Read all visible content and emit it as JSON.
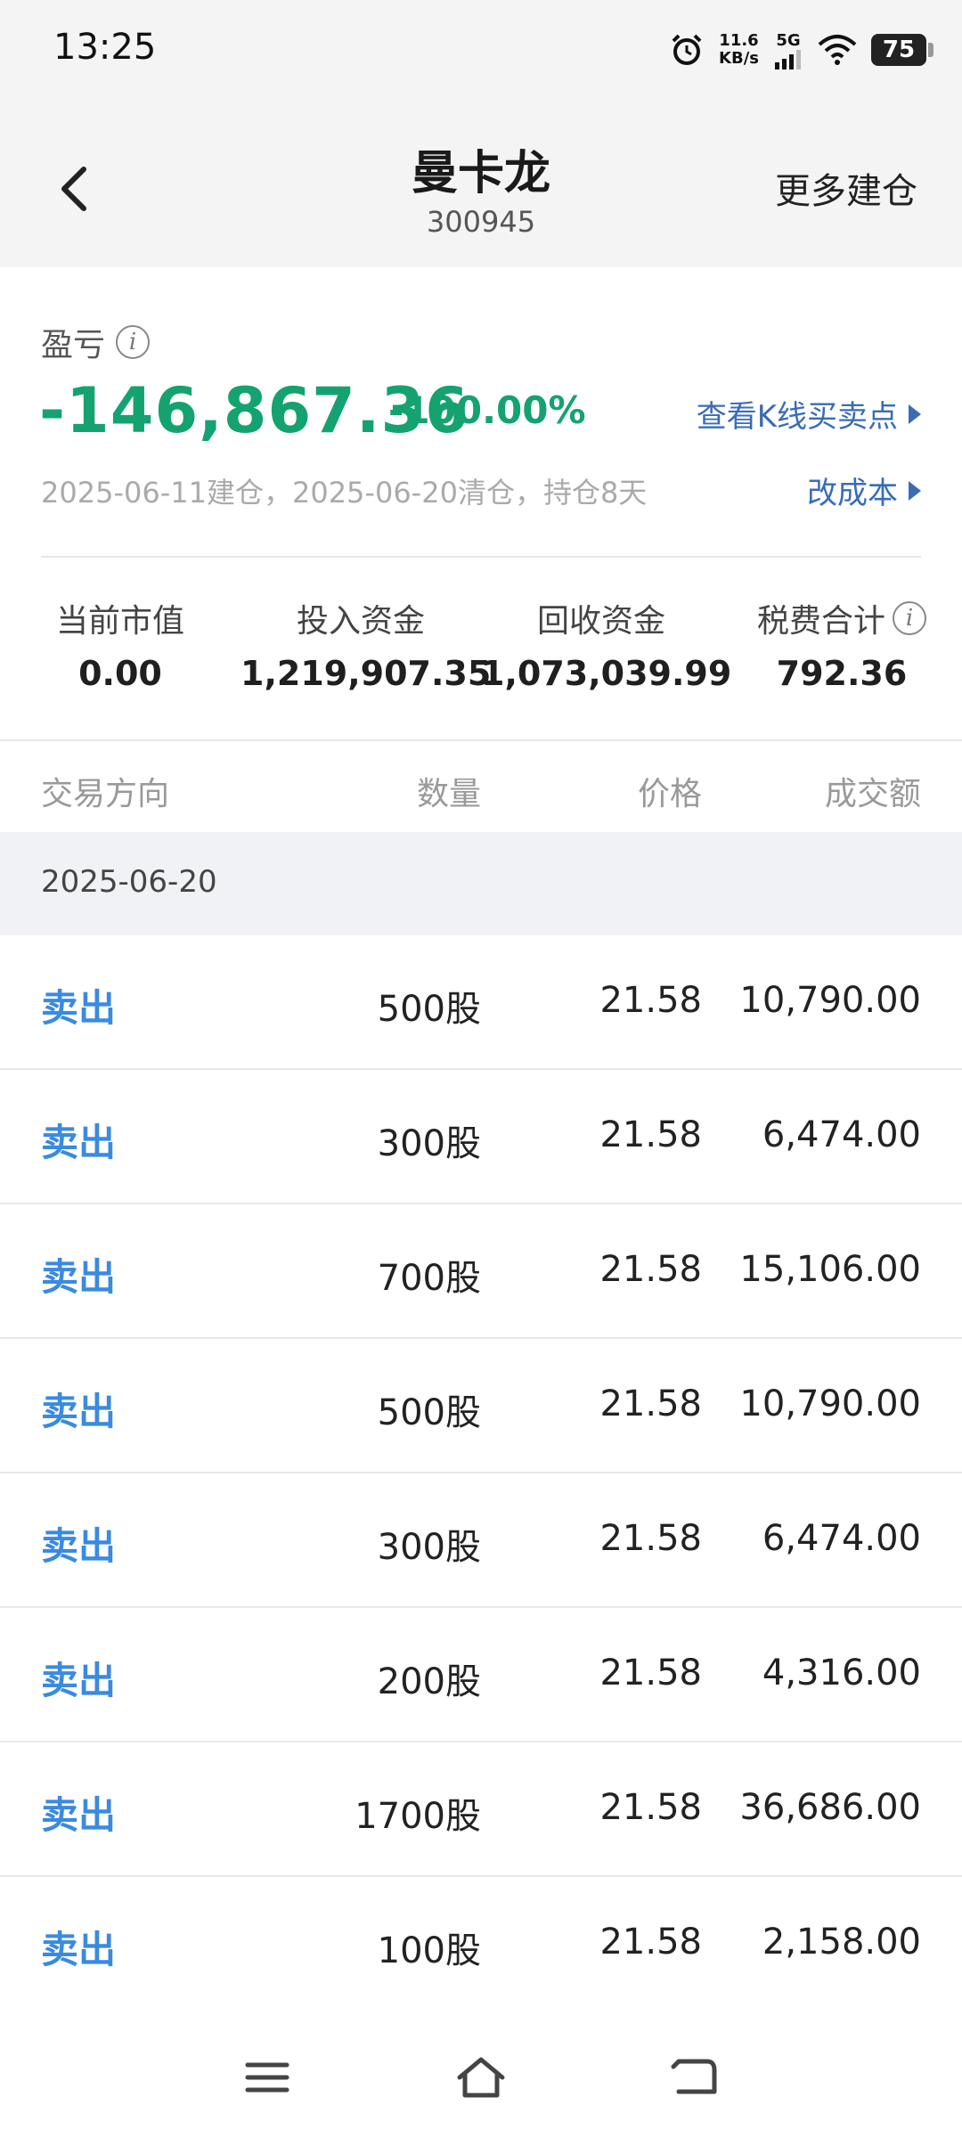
{
  "status": {
    "time": "13:25",
    "net_speed_value": "11.6",
    "net_speed_unit": "KB/s",
    "network": "5G",
    "battery": "75"
  },
  "nav": {
    "title": "曼卡龙",
    "code": "300945",
    "more": "更多建仓"
  },
  "summary": {
    "pl_label": "盈亏",
    "pl_value": "-146,867.36",
    "pl_pct": "-100.00%",
    "kline_link": "查看K线买卖点",
    "dates": "2025-06-11建仓，2025-06-20清仓，持仓8天",
    "cost_link": "改成本",
    "stats": [
      {
        "label": "当前市值",
        "value": "0.00"
      },
      {
        "label": "投入资金",
        "value": "1,219,907.35"
      },
      {
        "label": "回收资金",
        "value": "1,073,039.99"
      },
      {
        "label": "税费合计",
        "value": "792.36"
      }
    ],
    "colors": {
      "loss": "#14a370",
      "link": "#3a6cb5",
      "sell": "#3a8ae0"
    }
  },
  "table": {
    "headers": [
      "交易方向",
      "数量",
      "价格",
      "成交额"
    ],
    "date": "2025-06-20",
    "rows": [
      {
        "dir": "卖出",
        "qty": "500股",
        "price": "21.58",
        "amount": "10,790.00"
      },
      {
        "dir": "卖出",
        "qty": "300股",
        "price": "21.58",
        "amount": "6,474.00"
      },
      {
        "dir": "卖出",
        "qty": "700股",
        "price": "21.58",
        "amount": "15,106.00"
      },
      {
        "dir": "卖出",
        "qty": "500股",
        "price": "21.58",
        "amount": "10,790.00"
      },
      {
        "dir": "卖出",
        "qty": "300股",
        "price": "21.58",
        "amount": "6,474.00"
      },
      {
        "dir": "卖出",
        "qty": "200股",
        "price": "21.58",
        "amount": "4,316.00"
      },
      {
        "dir": "卖出",
        "qty": "1700股",
        "price": "21.58",
        "amount": "36,686.00"
      },
      {
        "dir": "卖出",
        "qty": "100股",
        "price": "21.58",
        "amount": "2,158.00"
      }
    ]
  },
  "icons": [
    "alarm-icon",
    "signal-icon",
    "wifi-icon",
    "battery-icon",
    "back-icon",
    "info-icon",
    "menu-icon",
    "home-icon",
    "return-icon"
  ]
}
